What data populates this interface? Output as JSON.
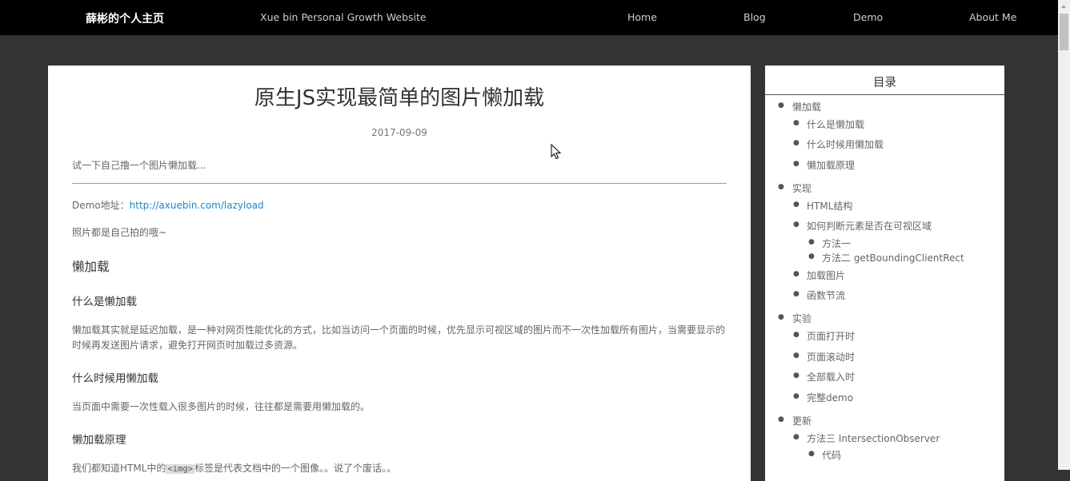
{
  "header": {
    "brand": "薛彬的个人主页",
    "tagline": "Xue bin Personal Growth Website",
    "nav": [
      "Home",
      "Blog",
      "Demo",
      "About Me"
    ]
  },
  "article": {
    "title": "原生JS实现最简单的图片懒加载",
    "date": "2017-09-09",
    "excerpt": "试一下自己撸一个图片懒加载...",
    "demo_label": "Demo地址：",
    "demo_link": "http://axuebin.com/lazyload",
    "photo_note": "照片都是自己拍的哦~",
    "h_lazy": "懒加载",
    "h_what": "什么是懒加载",
    "p1": "懒加载其实就是延迟加载，是一种对网页性能优化的方式，比如当访问一个页面的时候，优先显示可视区域的图片而不一次性加载所有图片，当需要显示的时候再发送图片请求，避免打开网页时加载过多资源。",
    "h_when": "什么时候用懒加载",
    "p2": "当页面中需要一次性载入很多图片的时候，往往都是需要用懒加载的。",
    "h_principle": "懒加载原理",
    "p3_before": "我们都知道HTML中的",
    "p3_code": "<img>",
    "p3_after": "标签是代表文档中的一个图像。。说了个废话。。"
  },
  "toc": {
    "title": "目录",
    "items": [
      "懒加载",
      "什么是懒加载",
      "什么时候用懒加载",
      "懒加载原理",
      "实现",
      "HTML结构",
      "如何判断元素是否在可视区域",
      "方法一",
      "方法二 getBoundingClientRect",
      "加载图片",
      "函数节流",
      "实验",
      "页面打开时",
      "页面滚动时",
      "全部载入时",
      "完整demo",
      "更新",
      "方法三 IntersectionObserver",
      "代码"
    ]
  }
}
